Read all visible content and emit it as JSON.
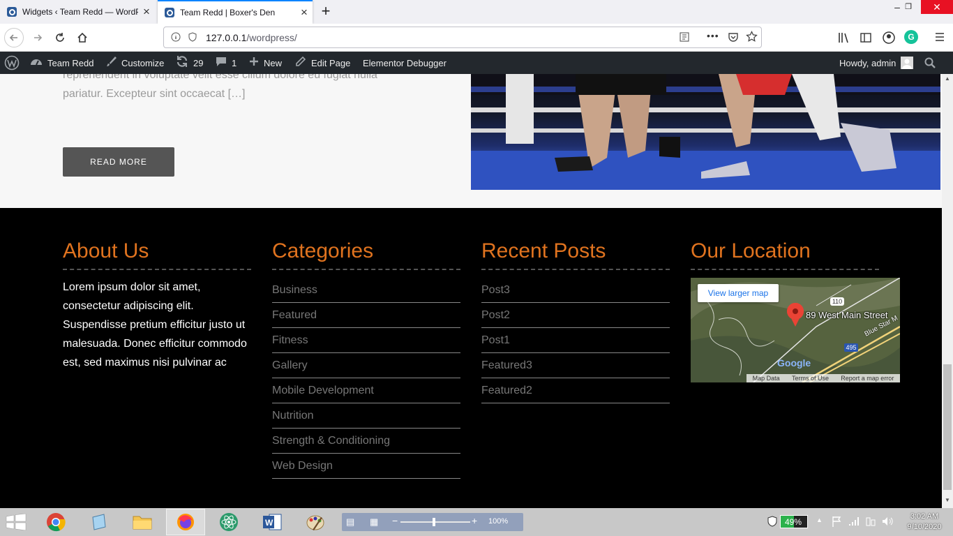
{
  "browser": {
    "tabs": [
      {
        "title": "Widgets ‹ Team Redd — WordPress",
        "close": "×"
      },
      {
        "title": "Team Redd | Boxer's Den",
        "close": "×"
      }
    ],
    "new_tab": "+",
    "window_controls": {
      "minimize": "–",
      "maximize": "❐",
      "close": "✕"
    },
    "url_host": "127.0.0.1",
    "url_path": "/wordpress/"
  },
  "admin_bar": {
    "site_name": "Team Redd",
    "customize": "Customize",
    "updates_count": "29",
    "comments_count": "1",
    "new": "New",
    "edit_page": "Edit Page",
    "debugger": "Elementor Debugger",
    "howdy": "Howdy, admin"
  },
  "post": {
    "excerpt": "reprehenderit in voluptate velit esse cillum dolore eu fugiat nulla pariatur. Excepteur sint occaecat […]",
    "read_more": "READ MORE"
  },
  "footer": {
    "about": {
      "heading": "About Us",
      "text": "Lorem ipsum dolor sit amet, consectetur adipiscing elit. Suspendisse pretium efficitur justo ut malesuada. Donec efficitur commodo est, sed maximus nisi pulvinar ac"
    },
    "categories": {
      "heading": "Categories",
      "items": [
        "Business",
        "Featured",
        "Fitness",
        "Gallery",
        "Mobile Development",
        "Nutrition",
        "Strength & Conditioning",
        "Web Design"
      ]
    },
    "recent_posts": {
      "heading": "Recent Posts",
      "items": [
        "Post3",
        "Post2",
        "Post1",
        "Featured3",
        "Featured2"
      ]
    },
    "location": {
      "heading": "Our Location",
      "view_larger": "View larger map",
      "address": "89 West Main Street",
      "road_label": "Blue Star M",
      "route_110": "110",
      "route_495": "495",
      "google": "Google",
      "map_data": "Map Data",
      "terms": "Terms of Use",
      "report": "Report a map error"
    }
  },
  "taskbar": {
    "battery_percent": "49%",
    "time": "3:02 AM",
    "date": "9/10/2020",
    "zoom": "100%"
  },
  "colors": {
    "accent_orange": "#e0731f",
    "admin_bar": "#23282d",
    "tab_highlight": "#0a84ff"
  }
}
